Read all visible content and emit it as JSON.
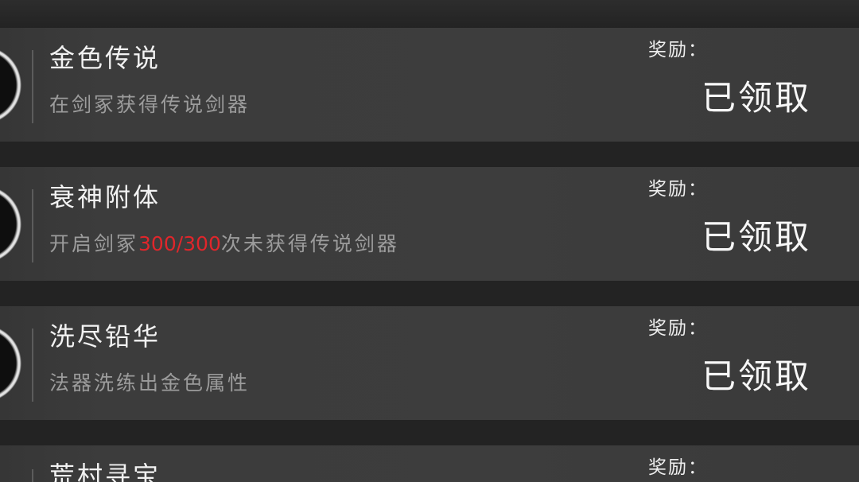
{
  "colors": {
    "background": "#232323",
    "panel": "#3d3d3d",
    "title_text": "#f2f2f2",
    "desc_text": "#9c9c9c",
    "highlight": "#e0262b"
  },
  "icons": {
    "emblem": "achievement-emblem-icon"
  },
  "achievements": [
    {
      "title": "金色传说",
      "desc": "在剑冢获得传说剑器",
      "reward_label": "奖励：",
      "status": "已领取"
    },
    {
      "title": "衰神附体",
      "desc_before": "开启剑冢",
      "desc_highlight": "300/300",
      "desc_after": "次未获得传说剑器",
      "reward_label": "奖励：",
      "status": "已领取"
    },
    {
      "title": "洗尽铅华",
      "desc": "法器洗练出金色属性",
      "reward_label": "奖励：",
      "status": "已领取"
    },
    {
      "title": "荒村寻宝",
      "reward_label": "奖励："
    }
  ]
}
